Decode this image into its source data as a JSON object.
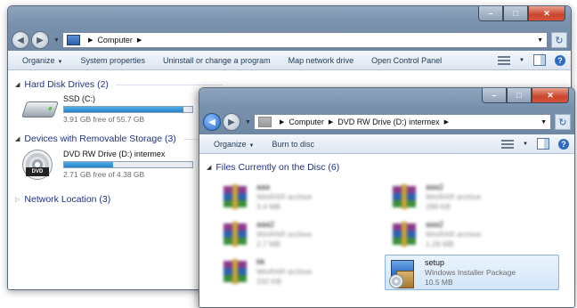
{
  "window1": {
    "address": [
      "Computer"
    ],
    "toolbar": [
      "Organize",
      "System properties",
      "Uninstall or change a program",
      "Map network drive",
      "Open Control Panel"
    ],
    "groups": {
      "hdd": "Hard Disk Drives (2)",
      "removable": "Devices with Removable Storage (3)",
      "network": "Network Location (3)"
    },
    "drives": [
      {
        "name": "SSD (C:)",
        "free": "3.91 GB free of 55.7 GB",
        "used_fraction": 0.93,
        "icon": "hard-drive-icon"
      },
      {
        "name": "DVD RW Drive (D:) intermex",
        "free": "2.71 GB free of 4.38 GB",
        "used_fraction": 0.38,
        "icon": "dvd-drive-icon",
        "badge": "DVD"
      }
    ]
  },
  "window2": {
    "address": [
      "Computer",
      "DVD RW Drive (D:) intermex"
    ],
    "toolbar": [
      "Organize",
      "Burn to disc"
    ],
    "group": "Files Currently on the Disc (6)",
    "files": [
      {
        "name": "aaa",
        "type": "WinRAR archive",
        "size": "3.4 MB",
        "blurred": true
      },
      {
        "name": "aaa2",
        "type": "WinRAR archive",
        "size": "289 KB",
        "blurred": true
      },
      {
        "name": "aaa2",
        "type": "WinRAR archive",
        "size": "2.7 MB",
        "blurred": true
      },
      {
        "name": "aaa2",
        "type": "WinRAR archive",
        "size": "1.28 MB",
        "blurred": true
      },
      {
        "name": "bk",
        "type": "WinRAR archive",
        "size": "232 KB",
        "blurred": true
      },
      {
        "name": "setup",
        "type": "Windows Installer Package",
        "size": "10.5 MB",
        "selected": true
      }
    ]
  },
  "caption": {
    "minimize": "–",
    "maximize": "□",
    "close": "✕"
  },
  "colors": {
    "accent": "#2680c9",
    "group_heading": "#1e3287"
  }
}
